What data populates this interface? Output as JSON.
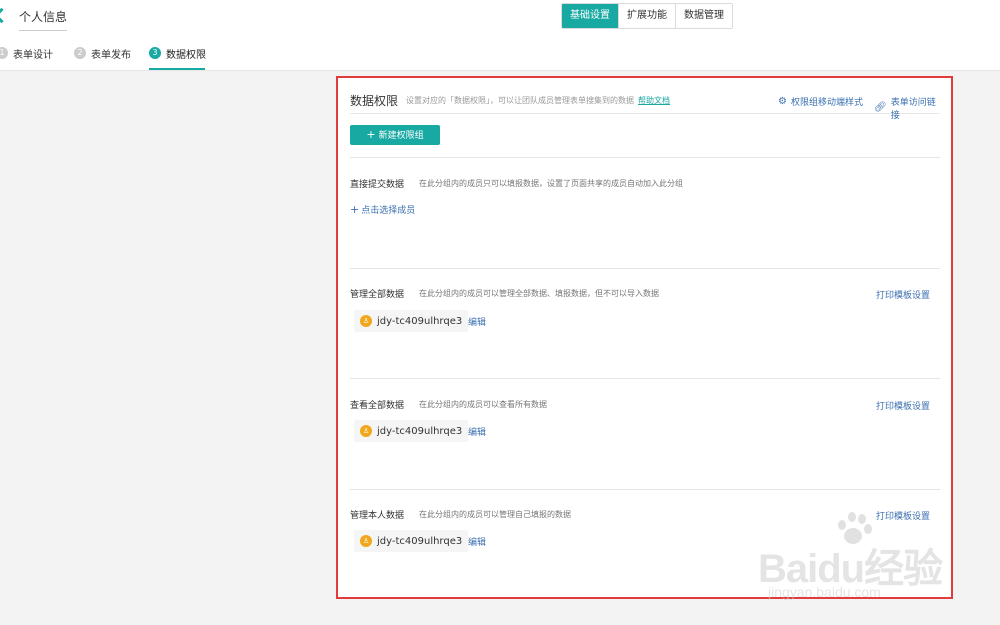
{
  "header": {
    "form_title": "个人信息",
    "tabs": [
      {
        "label": "基础设置",
        "active": true
      },
      {
        "label": "扩展功能",
        "active": false
      },
      {
        "label": "数据管理",
        "active": false
      }
    ]
  },
  "steps": [
    {
      "num": "1",
      "label": "表单设计",
      "active": false
    },
    {
      "num": "2",
      "label": "表单发布",
      "active": false
    },
    {
      "num": "3",
      "label": "数据权限",
      "active": true
    }
  ],
  "panel": {
    "title": "数据权限",
    "desc": "设置对应的「数据权限」，可以让团队成员管理表单搜集到的数据",
    "help_link": "帮助文档",
    "link_style": "权限组移动端样式",
    "link_access": "表单访问链接",
    "new_group_button": "新建权限组",
    "print_label": "打印模板设置",
    "edit_label": "编辑",
    "add_member_label": "点击选择成员",
    "groups": [
      {
        "title": "直接提交数据",
        "desc": "在此分组内的成员只可以填报数据，设置了页面共享的成员自动加入此分组"
      },
      {
        "title": "管理全部数据",
        "desc": "在此分组内的成员可以管理全部数据、填报数据，但不可以导入数据",
        "member": "jdy-tc409ulhrqe3"
      },
      {
        "title": "查看全部数据",
        "desc": "在此分组内的成员可以查看所有数据",
        "member": "jdy-tc409ulhrqe3"
      },
      {
        "title": "管理本人数据",
        "desc": "在此分组内的成员可以管理自己填报的数据",
        "member": "jdy-tc409ulhrqe3"
      }
    ]
  },
  "watermark": {
    "logo": "Baidu经验",
    "url": "jingyan.baidu.com"
  },
  "colors": {
    "accent": "#19a9a3",
    "link": "#3a6fb0",
    "highlight": "#e03c3c",
    "avatar": "#f0a71b"
  }
}
